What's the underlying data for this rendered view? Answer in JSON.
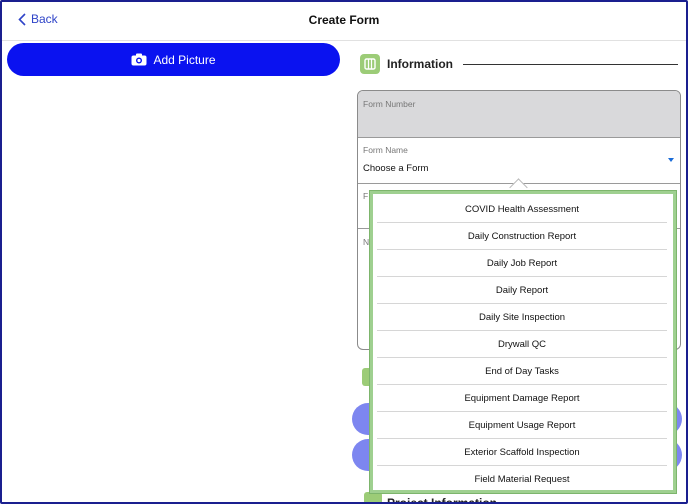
{
  "nav": {
    "back_label": "Back",
    "title": "Create Form"
  },
  "add_picture": {
    "label": "Add Picture"
  },
  "information": {
    "title": "Information"
  },
  "fields": {
    "form_number_label": "Form Number",
    "form_name_label": "Form Name",
    "form_name_value": "Choose a Form",
    "field3_label": "F",
    "field4_label": "N"
  },
  "project_information": {
    "title": "Project Information"
  },
  "form_options": [
    "COVID Health Assessment",
    "Daily Construction Report",
    "Daily Job Report",
    "Daily Report",
    "Daily Site Inspection",
    "Drywall QC",
    "End of Day Tasks",
    "Equipment Damage Report",
    "Equipment Usage Report",
    "Exterior Scaffold Inspection",
    "Field Material Request"
  ],
  "colors": {
    "accent_blue": "#0a12f0",
    "link_blue": "#2f44c8",
    "section_green": "#9ccc77",
    "pill_blue": "#7d86f0"
  },
  "icons": {
    "back": "chevron-left-icon",
    "camera": "camera-icon",
    "info": "grid-icon",
    "dropdown": "caret-down-icon"
  }
}
